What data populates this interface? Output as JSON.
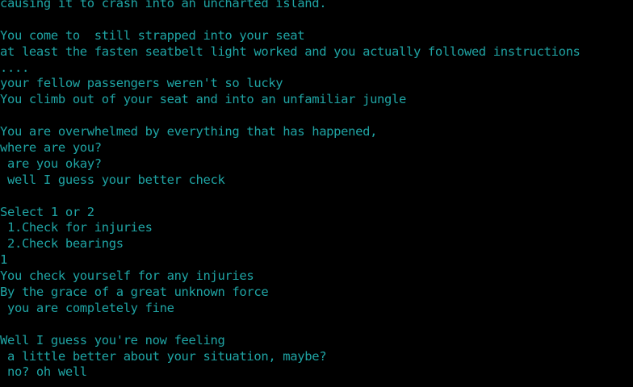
{
  "colors": {
    "background": "#000000",
    "text": "#1fa4a4"
  },
  "terminal": {
    "lines": [
      "causing it to crash into an uncharted island.",
      "",
      "You come to  still strapped into your seat",
      "at least the fasten seatbelt light worked and you actually followed instructions",
      "....",
      "your fellow passengers weren't so lucky",
      "You climb out of your seat and into an unfamiliar jungle",
      "",
      "You are overwhelmed by everything that has happened,",
      "where are you?",
      " are you okay?",
      " well I guess your better check",
      "",
      "Select 1 or 2",
      " 1.Check for injuries",
      " 2.Check bearings",
      "1",
      "You check yourself for any injuries",
      "By the grace of a great unknown force",
      " you are completely fine",
      "",
      "Well I guess you're now feeling",
      " a little better about your situation, maybe?",
      " no? oh well"
    ]
  }
}
